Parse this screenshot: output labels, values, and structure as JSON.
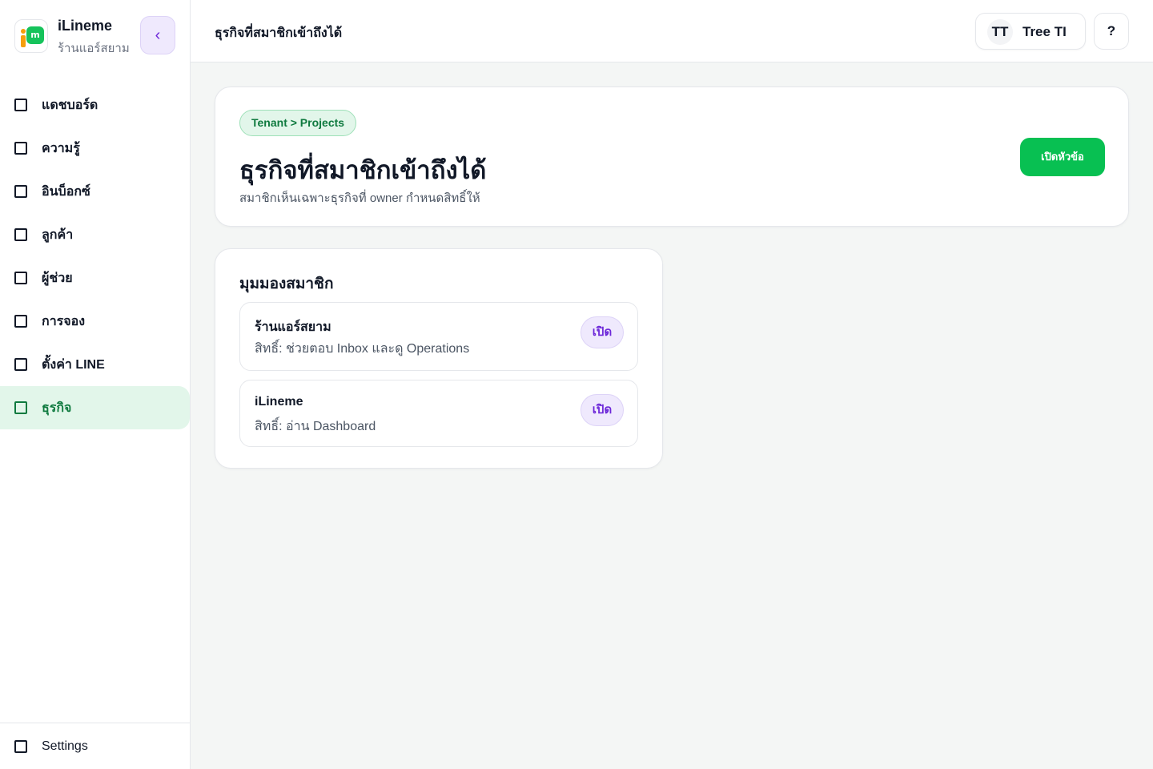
{
  "brand": {
    "name": "iLineme",
    "subtitle": "ร้านแอร์สยาม",
    "logo_glyph": "m",
    "collapse_glyph": "‹"
  },
  "sidebar": {
    "items": [
      {
        "label": "แดชบอร์ด",
        "active": false
      },
      {
        "label": "ความรู้",
        "active": false
      },
      {
        "label": "อินบ็อกซ์",
        "active": false
      },
      {
        "label": "ลูกค้า",
        "active": false
      },
      {
        "label": "ผู้ช่วย",
        "active": false
      },
      {
        "label": "การจอง",
        "active": false
      },
      {
        "label": "ตั้งค่า LINE",
        "active": false
      },
      {
        "label": "ธุรกิจ",
        "active": true
      }
    ],
    "footer_label": "Settings"
  },
  "header": {
    "title": "ธุรกิจที่สมาชิกเข้าถึงได้",
    "user_initials": "TT",
    "user_name": "Tree TI",
    "help_label": "?"
  },
  "hero": {
    "breadcrumb": "Tenant > Projects",
    "title": "ธุรกิจที่สมาชิกเข้าถึงได้",
    "subtitle": "สมาชิกเห็นเฉพาะธุรกิจที่ owner กำหนดสิทธิ์ให้",
    "action_label": "เปิดหัวข้อ"
  },
  "member_view": {
    "title": "มุมมองสมาชิก",
    "businesses": [
      {
        "name": "ร้านแอร์สยาม",
        "permission": "สิทธิ์: ช่วยตอบ Inbox และดู Operations",
        "open_label": "เปิด"
      },
      {
        "name": "iLineme",
        "permission": "สิทธิ์: อ่าน Dashboard",
        "open_label": "เปิด"
      }
    ]
  },
  "colors": {
    "accent_green": "#08c052",
    "active_bg": "#e2f6ea",
    "active_text": "#0f7a3f",
    "purple_accent": "#6d28d9",
    "purple_bg": "#efe9fd"
  }
}
